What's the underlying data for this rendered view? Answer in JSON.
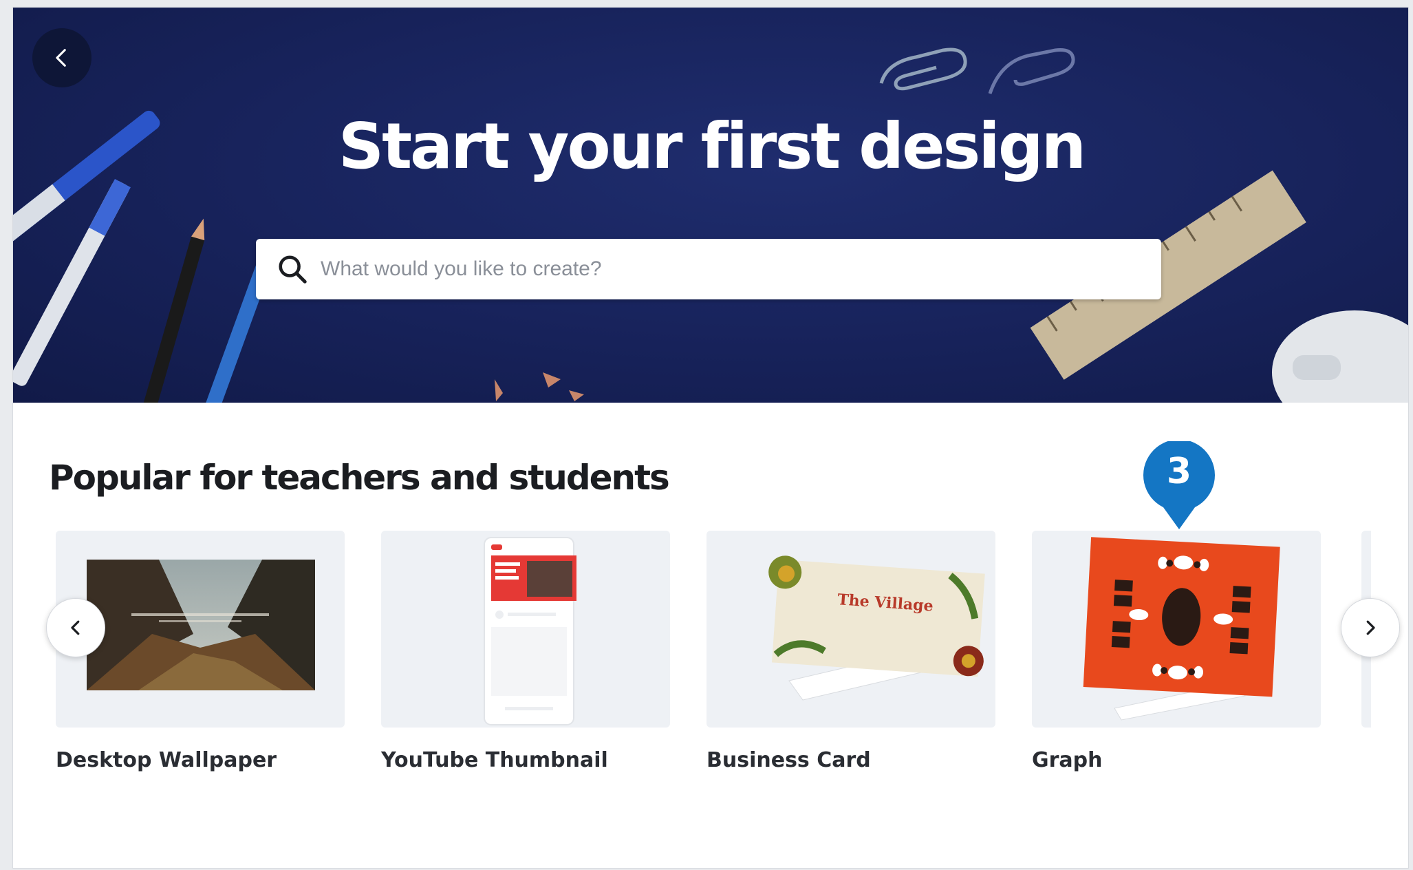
{
  "hero": {
    "title": "Start your first design",
    "search_placeholder": "What would you like to create?"
  },
  "section": {
    "title": "Popular for teachers and students"
  },
  "cards": [
    {
      "label": "Desktop Wallpaper"
    },
    {
      "label": "YouTube Thumbnail"
    },
    {
      "label": "Business Card"
    },
    {
      "label": "Graph"
    }
  ],
  "thumb_text": {
    "business_card": "The Village"
  },
  "badge": {
    "number": "3"
  },
  "icons": {
    "back": "chevron-left-icon",
    "search": "search-icon",
    "carousel_prev": "chevron-left-icon",
    "carousel_next": "chevron-right-icon"
  },
  "colors": {
    "hero_bg": "#17225a",
    "badge": "#1476c4",
    "graph_card": "#e8491d"
  }
}
